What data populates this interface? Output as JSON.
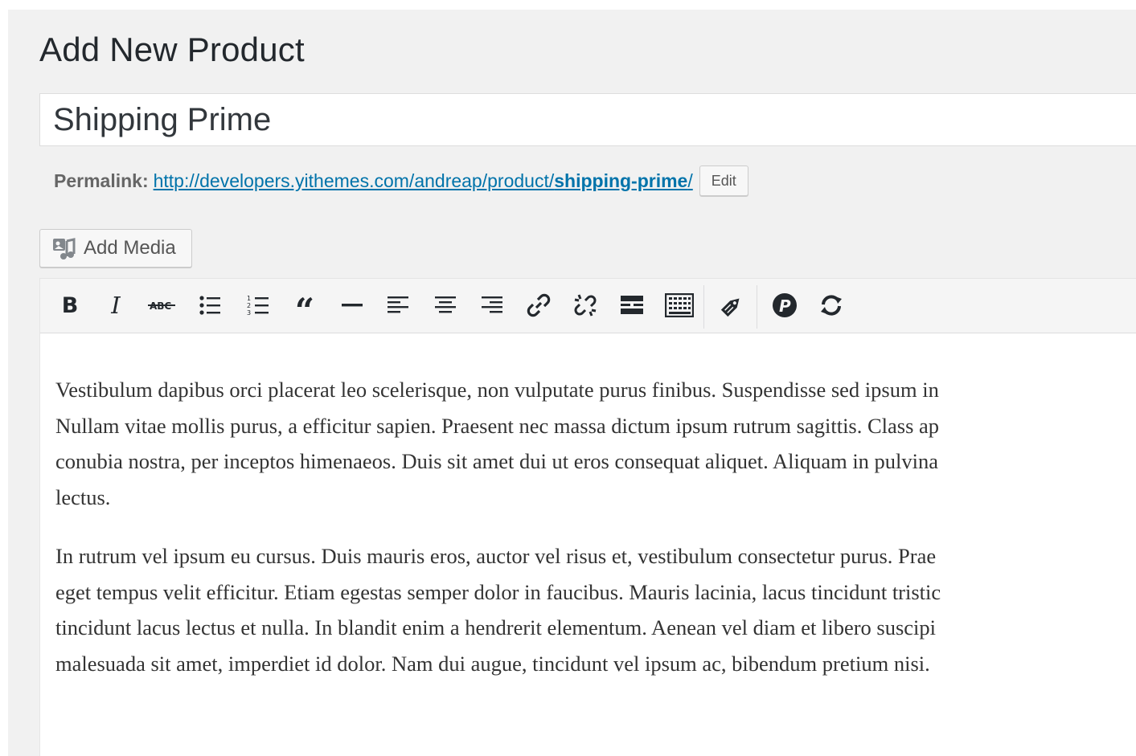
{
  "page": {
    "title": "Add New Product"
  },
  "product": {
    "title_value": "Shipping Prime"
  },
  "permalink": {
    "label": "Permalink:",
    "url_base": "http://developers.yithemes.com/andreap/product/",
    "slug": "shipping-prime",
    "url_trailing": "/",
    "edit_label": "Edit"
  },
  "media": {
    "add_label": "Add Media"
  },
  "toolbar": {
    "buttons": [
      {
        "name": "bold-icon",
        "glyph": "B"
      },
      {
        "name": "italic-icon",
        "glyph": "I"
      },
      {
        "name": "strikethrough-icon",
        "glyph": "ABC"
      },
      {
        "name": "bulleted-list-icon"
      },
      {
        "name": "numbered-list-icon"
      },
      {
        "name": "blockquote-icon",
        "glyph": "“"
      },
      {
        "name": "horizontal-line-icon"
      },
      {
        "name": "align-left-icon"
      },
      {
        "name": "align-center-icon"
      },
      {
        "name": "align-right-icon"
      },
      {
        "name": "insert-link-icon"
      },
      {
        "name": "remove-link-icon"
      },
      {
        "name": "read-more-icon"
      },
      {
        "name": "toolbar-toggle-icon"
      },
      {
        "name": "shortcode-icon"
      },
      {
        "name": "plugin-p-icon"
      },
      {
        "name": "refresh-icon"
      }
    ]
  },
  "content": {
    "paragraph_1": [
      "Vestibulum dapibus orci placerat leo scelerisque, non vulputate purus finibus. Suspendisse sed ipsum in",
      "Nullam vitae mollis purus, a efficitur sapien. Praesent nec massa dictum ipsum rutrum sagittis. Class ap",
      "conubia nostra, per inceptos himenaeos. Duis sit amet dui ut eros consequat aliquet. Aliquam in pulvina",
      "lectus."
    ],
    "paragraph_2": [
      "In rutrum vel ipsum eu cursus. Duis mauris eros, auctor vel risus et, vestibulum consectetur purus. Prae",
      "eget tempus velit efficitur. Etiam egestas semper dolor in faucibus. Mauris lacinia, lacus tincidunt tristic",
      "tincidunt lacus lectus et nulla. In blandit enim a hendrerit elementum. Aenean vel diam et libero suscipi",
      "malesuada sit amet, imperdiet id dolor. Nam dui augue, tincidunt vel ipsum ac, bibendum pretium nisi."
    ]
  },
  "colors": {
    "link": "#0073aa",
    "background": "#f1f1f1",
    "text": "#23282d"
  }
}
